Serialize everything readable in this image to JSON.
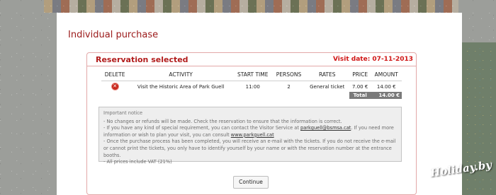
{
  "page": {
    "title": "Individual purchase",
    "watermark": "Holiday.by"
  },
  "reservation": {
    "title": "Reservation selected",
    "visit_date": "Visit date: 07-11-2013",
    "columns": [
      "DELETE",
      "ACTIVITY",
      "START TIME",
      "PERSONS",
      "RATES",
      "PRICE",
      "AMOUNT"
    ],
    "row": {
      "delete_icon": "x-circle-icon",
      "activity": "Visit the Historic Area of Park Guell",
      "start_time": "11:00",
      "persons": "2",
      "rate": "General ticket",
      "price": "7.00 €",
      "amount": "14.00 €"
    },
    "total_label": "Total",
    "total_value": "14.00 €"
  },
  "notice": {
    "title": "Important notice",
    "line1": "- No changes or refunds will be made. Check the reservation to ensure that the information is correct.",
    "line2_pre": "- If you have any kind of special requirement, you can contact the Visitor Service at ",
    "line2_email": "parkguell@bsmsa.cat",
    "line2_post": ". If you need more information or wish to plan your visit, you can consult ",
    "line2_link": "www.parkguell.cat",
    "line3": "- Once the purchase process has been completed, you will receive an e-mail with the tickets. If you do not receive the e-mail or cannot print the tickets, you only have to identify yourself by your name or with the reservation number at the entrance booths.",
    "line4": "- All prices include VAT (21%)"
  },
  "actions": {
    "continue_label": "Continue"
  },
  "colors": {
    "title_red": "#9b1a1a",
    "accent_red": "#d01616",
    "total_gray": "#7a7a7a"
  }
}
